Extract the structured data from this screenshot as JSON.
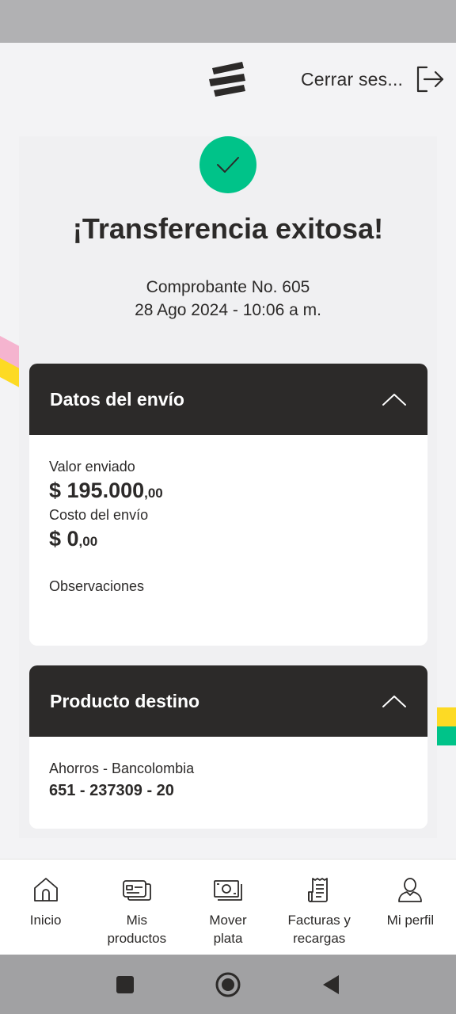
{
  "header": {
    "logo_icon": "bancolombia-logo-icon",
    "logout_label": "Cerrar ses...",
    "logout_icon": "logout-arrow-icon"
  },
  "success": {
    "icon": "check-icon",
    "title": "¡Transferencia exitosa!",
    "receipt_number": "Comprobante No. 605",
    "datetime": "28 Ago 2024 - 10:06 a m."
  },
  "shipment": {
    "title": "Datos del envío",
    "collapse_icon": "chevron-up-icon",
    "sent_value_label": "Valor enviado",
    "sent_value_main": "$ 195.000",
    "sent_value_cents": ",00",
    "cost_label": "Costo del envío",
    "cost_main": "$ 0",
    "cost_cents": ",00",
    "notes_label": "Observaciones"
  },
  "destination": {
    "title": "Producto destino",
    "collapse_icon": "chevron-up-icon",
    "account_type": "Ahorros - Bancolombia",
    "account_number": "651 - 237309 - 20"
  },
  "bottom_nav": [
    {
      "label": "Inicio",
      "icon": "home-icon"
    },
    {
      "label": "Mis\nproductos",
      "icon": "cards-icon"
    },
    {
      "label": "Mover\nplata",
      "icon": "money-icon"
    },
    {
      "label": "Facturas y\nrecargas",
      "icon": "receipt-icon"
    },
    {
      "label": "Mi perfil",
      "icon": "user-icon"
    }
  ],
  "colors": {
    "accent_green": "#00c389",
    "brand_yellow": "#fdda24",
    "brand_pink": "#f5b4cf",
    "dark": "#2c2a29"
  }
}
